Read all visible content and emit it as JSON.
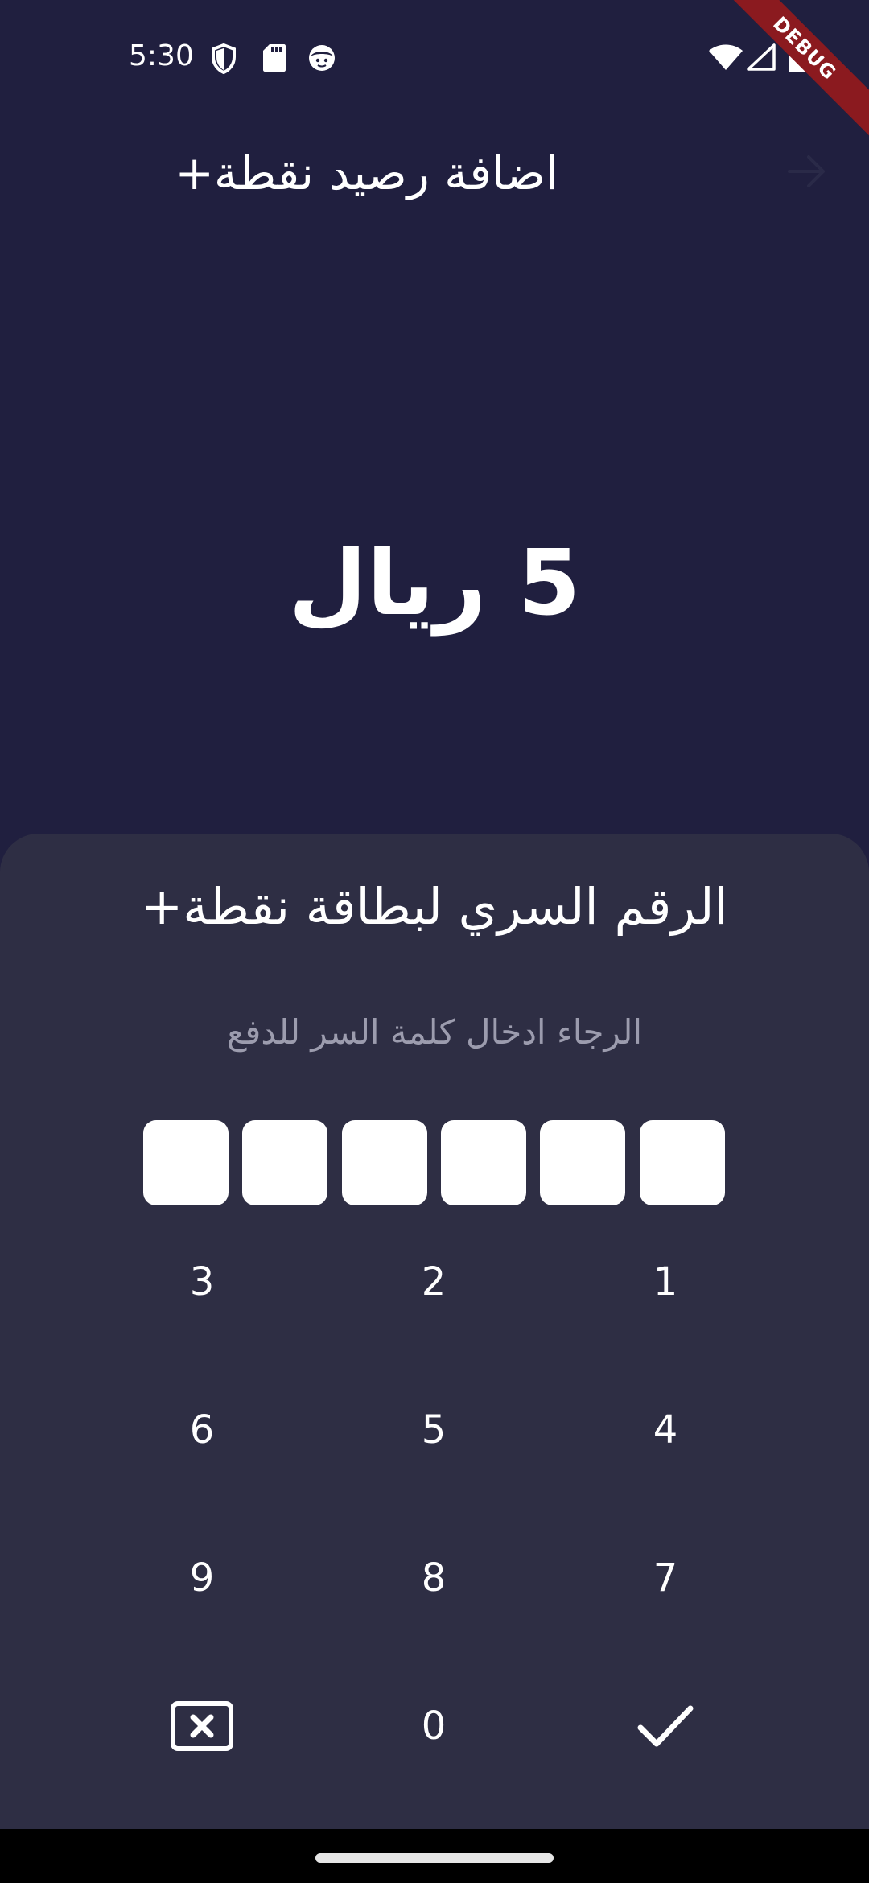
{
  "status_bar": {
    "time": "5:30",
    "icons": [
      "shield-icon",
      "sd-card-icon",
      "face-icon",
      "wifi-icon",
      "signal-icon",
      "battery-icon"
    ]
  },
  "debug_banner": "DEBUG",
  "app_bar": {
    "title": "اضافة رصيد نقطة+",
    "back_icon": "arrow-forward-icon"
  },
  "amount": "5 ريال",
  "sheet": {
    "title": "الرقم السري لبطاقة نقطة+",
    "subtitle": "الرجاء ادخال كلمة السر للدفع",
    "pin_length": 6
  },
  "keypad": {
    "rows": [
      [
        "3",
        "2",
        "1"
      ],
      [
        "6",
        "5",
        "4"
      ],
      [
        "9",
        "8",
        "7"
      ]
    ],
    "zero": "0",
    "delete_icon": "backspace-icon",
    "confirm_icon": "check-icon"
  },
  "colors": {
    "background": "#201f3f",
    "sheet": "#2e2e44",
    "subtitle": "#9c9cae",
    "debug_banner": "#8b1a1f",
    "pin_box": "#ffffff"
  }
}
